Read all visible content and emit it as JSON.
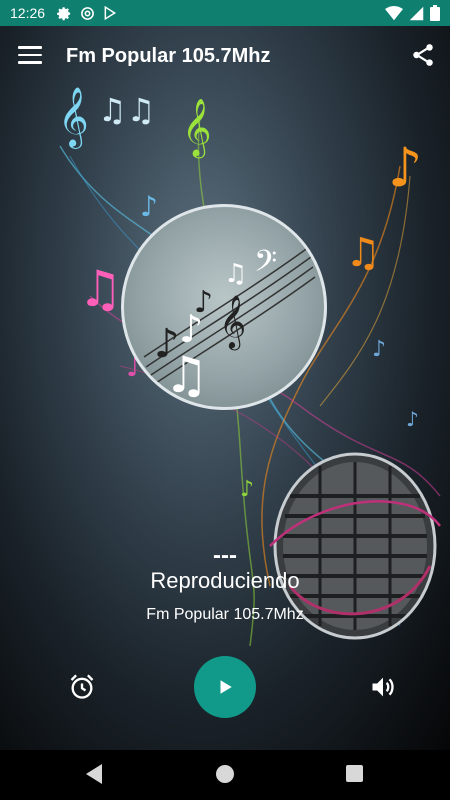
{
  "status_bar": {
    "time": "12:26",
    "icons": [
      "gear-icon",
      "at-icon",
      "play-store-icon"
    ],
    "right_icons": [
      "wifi-icon",
      "signal-icon",
      "battery-icon"
    ]
  },
  "app_bar": {
    "title": "Fm Popular 105.7Mhz",
    "menu_icon": "menu-icon",
    "share_icon": "share-icon"
  },
  "player": {
    "song_title": "---",
    "status": "Reproduciendo",
    "station": "Fm Popular 105.7Mhz"
  },
  "controls": {
    "left_icon": "alarm-icon",
    "center_icon": "play-icon",
    "right_icon": "volume-icon",
    "accent_color": "#11998a"
  },
  "colors": {
    "status_bar_bg": "#0f7f6f",
    "nav_bar_bg": "#000000"
  },
  "nav_bar": {
    "back_icon": "back-icon",
    "home_icon": "home-icon",
    "recent_icon": "recent-apps-icon"
  }
}
